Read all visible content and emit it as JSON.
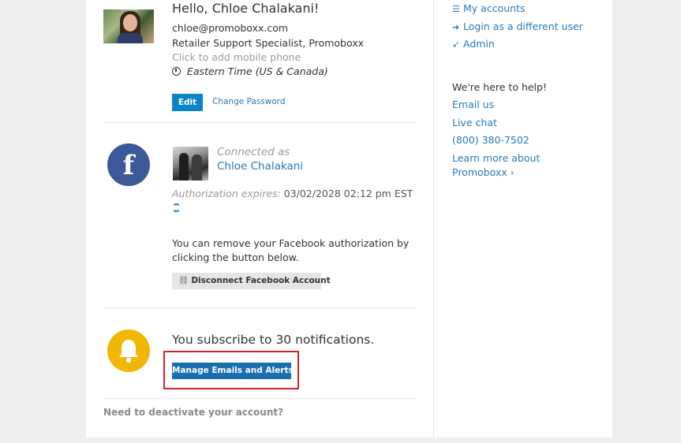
{
  "profile": {
    "greeting": "Hello, Chloe Chalakani!",
    "email": "chloe@promoboxx.com",
    "title": "Retailer Support Specialist, Promoboxx",
    "phone_placeholder": "Click to add mobile phone",
    "timezone": "Eastern Time (US & Canada)",
    "edit_label": "Edit",
    "change_password_label": "Change Password"
  },
  "facebook": {
    "icon_letter": "f",
    "connected_as_label": "Connected as",
    "name": "Chloe Chalakani",
    "auth_label": "Authorization expires:",
    "auth_value": "03/02/2028 02:12 pm EST",
    "remove_line1": "You can remove your Facebook authorization by",
    "remove_line2": "clicking the button below.",
    "disconnect_label": "Disconnect Facebook Account"
  },
  "notifications": {
    "summary": "You subscribe to 30 notifications.",
    "manage_label": "Manage Emails and Alerts"
  },
  "deactivate_label": "Need to deactivate your account?",
  "sidebar": {
    "my_accounts": "My accounts",
    "login_different": "Login as a different user",
    "admin": "Admin",
    "help_title": "We're here to help!",
    "email_us": "Email us",
    "live_chat": "Live chat",
    "phone": "(800) 380-7502",
    "learn_more_line1": "Learn more about",
    "learn_more_line2": "Promoboxx"
  },
  "colors": {
    "primary_button": "#0b84c6",
    "manage_button": "#1a6fb0",
    "link": "#2a79b8",
    "facebook": "#3b5998",
    "bell": "#f2b705",
    "highlight_box": "#d0232a"
  },
  "icons": [
    "list-icon",
    "sign-in-icon",
    "rocket-icon",
    "clock-icon",
    "refresh-icon",
    "unlink-icon",
    "facebook-icon",
    "bell-icon",
    "chevron-right-icon"
  ]
}
